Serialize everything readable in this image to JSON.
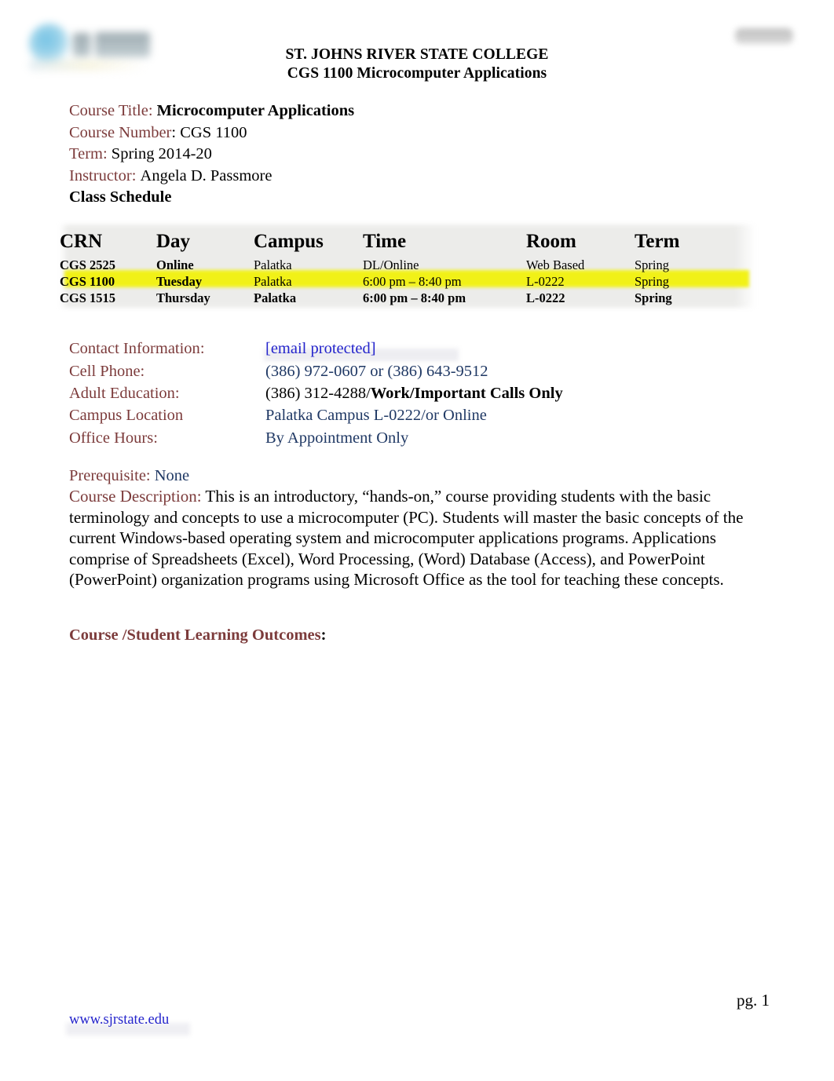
{
  "header": {
    "logo_left_name": "sjr-state-college-logo",
    "logo_right_name": "secondary-seal-logo",
    "line1": "ST. JOHNS RIVER STATE COLLEGE",
    "line2_prefix": "CGS 1100 ",
    "line2_rest": "Microcomputer Applications"
  },
  "meta": {
    "course_title_label": "Course Title:",
    "course_title_value": "Microcomputer Applications",
    "course_number_label": "Course Number",
    "course_number_value": ": CGS 1100",
    "term_label": "Term:",
    "term_value": "Spring 2014-20",
    "instructor_label": "Instructor:",
    "instructor_value": "Angela D. Passmore",
    "class_schedule_label": "Class Schedule"
  },
  "schedule": {
    "columns": [
      "CRN",
      "Day",
      "Campus",
      "Time",
      "Room",
      "Term"
    ],
    "rows": [
      {
        "crn": "CGS 2525",
        "day": "Online",
        "campus": "Palatka",
        "time": "DL/Online",
        "room": "Web Based",
        "term": "Spring",
        "highlight": false
      },
      {
        "crn": "CGS 1100",
        "day": "Tuesday",
        "campus": "Palatka",
        "time": "6:00 pm – 8:40 pm",
        "room": "L-0222",
        "term": "Spring",
        "highlight": true
      },
      {
        "crn": "CGS 1515",
        "day": "Thursday",
        "campus": "Palatka",
        "time": "6:00 pm – 8:40 pm",
        "room": "L-0222",
        "term": "Spring",
        "highlight": false
      }
    ],
    "highlight_color": "#F2F20C"
  },
  "contact": {
    "information_label": "Contact Information",
    "information_colon": ":",
    "information_value": "[email protected]",
    "cell_label": "Cell Phone:",
    "cell_value": " (386) 972-0607 or (386) 643-9512",
    "adult_ed_label": "Adult Education:",
    "adult_ed_value": "(386) 312-4288/",
    "adult_ed_value_bold": "Work/Important Calls Only",
    "campus_label": "Campus Location",
    "campus_value_bold": "Palatka Campus",
    "campus_value_rest": " L-0222/or Online",
    "office_hours_label": "Office Hours",
    "office_hours_colon": ":",
    "office_hours_value": "By Appointment Only"
  },
  "content": {
    "prereq_label": "Prerequisite",
    "prereq_colon": ":",
    "prereq_value": " None",
    "description_label": "Course Description:",
    "description_text": " This is an introductory, “hands-on,” course providing students with the basic terminology and concepts to use a microcomputer (PC). Students will master the basic concepts of the current Windows-based operating system and microcomputer applications programs. Applications comprise of Spreadsheets (Excel), Word Processing, (Word) Database (Access), and PowerPoint (PowerPoint) organization programs using Microsoft Office as the tool for teaching these concepts.",
    "outcomes_label": "Course /Student Learning Outcomes",
    "outcomes_colon": ":"
  },
  "footer": {
    "page_number": "pg. 1",
    "website": "www.sjrstate.edu"
  },
  "colors": {
    "label_maroon": "#7C3B3B",
    "link_blue": "#2424CC",
    "value_navy": "#1F3864",
    "highlight_yellow": "#F2F20C"
  }
}
